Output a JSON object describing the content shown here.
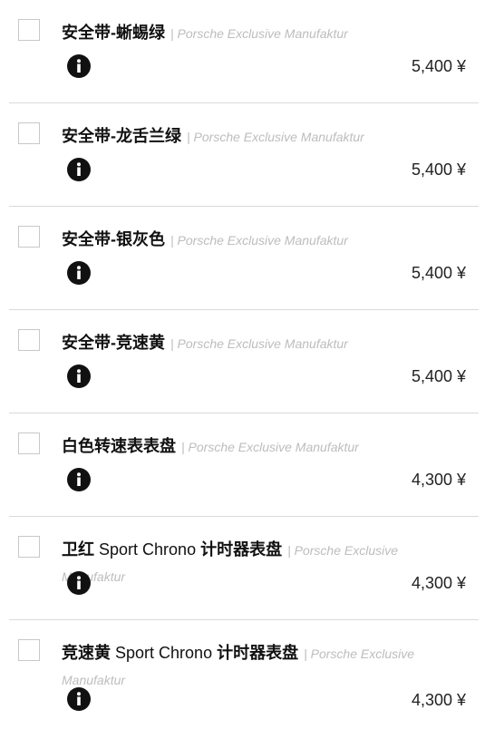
{
  "brand_suffix": "| Porsche Exclusive Manufaktur",
  "currency": "¥",
  "options": [
    {
      "name": "安全带-蜥蜴绿",
      "price": "5,400 ¥"
    },
    {
      "name": "安全带-龙舌兰绿",
      "price": "5,400 ¥"
    },
    {
      "name": "安全带-银灰色",
      "price": "5,400 ¥"
    },
    {
      "name": "安全带-竞速黄",
      "price": "5,400 ¥"
    },
    {
      "name": "白色转速表表盘",
      "price": "4,300 ¥"
    },
    {
      "name_prefix": "卫红 ",
      "name_latin": "Sport Chrono",
      "name_suffix": " 计时器表盘",
      "price": "4,300 ¥"
    },
    {
      "name_prefix": "竞速黄 ",
      "name_latin": "Sport Chrono",
      "name_suffix": " 计时器表盘",
      "price": "4,300 ¥"
    }
  ]
}
